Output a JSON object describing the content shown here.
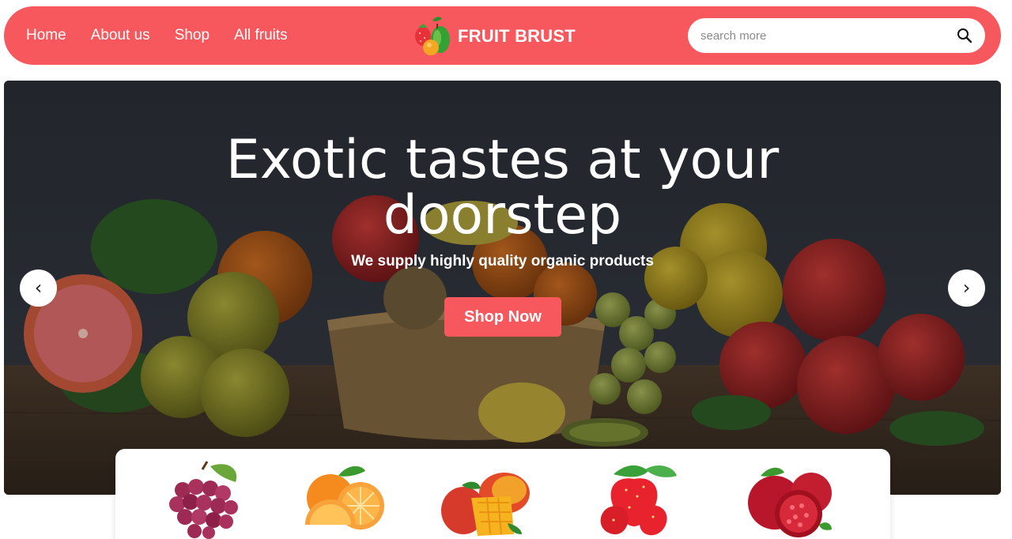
{
  "nav": {
    "links": [
      "Home",
      "About us",
      "Shop",
      "All fruits"
    ],
    "brand": "FRUIT BRUST",
    "search_placeholder": "search more"
  },
  "hero": {
    "title_line1": "Exotic tastes at your",
    "title_line2": "doorstep",
    "subtitle": "We supply highly quality organic products",
    "cta": "Shop Now",
    "prev_label": "‹",
    "next_label": "›"
  },
  "categories": [
    {
      "icon": "grapes-icon"
    },
    {
      "icon": "orange-icon"
    },
    {
      "icon": "mango-icon"
    },
    {
      "icon": "strawberry-icon"
    },
    {
      "icon": "pomegranate-icon"
    }
  ],
  "colors": {
    "accent": "#f7585e",
    "hero_bg": "#2b2f38",
    "white": "#ffffff"
  }
}
